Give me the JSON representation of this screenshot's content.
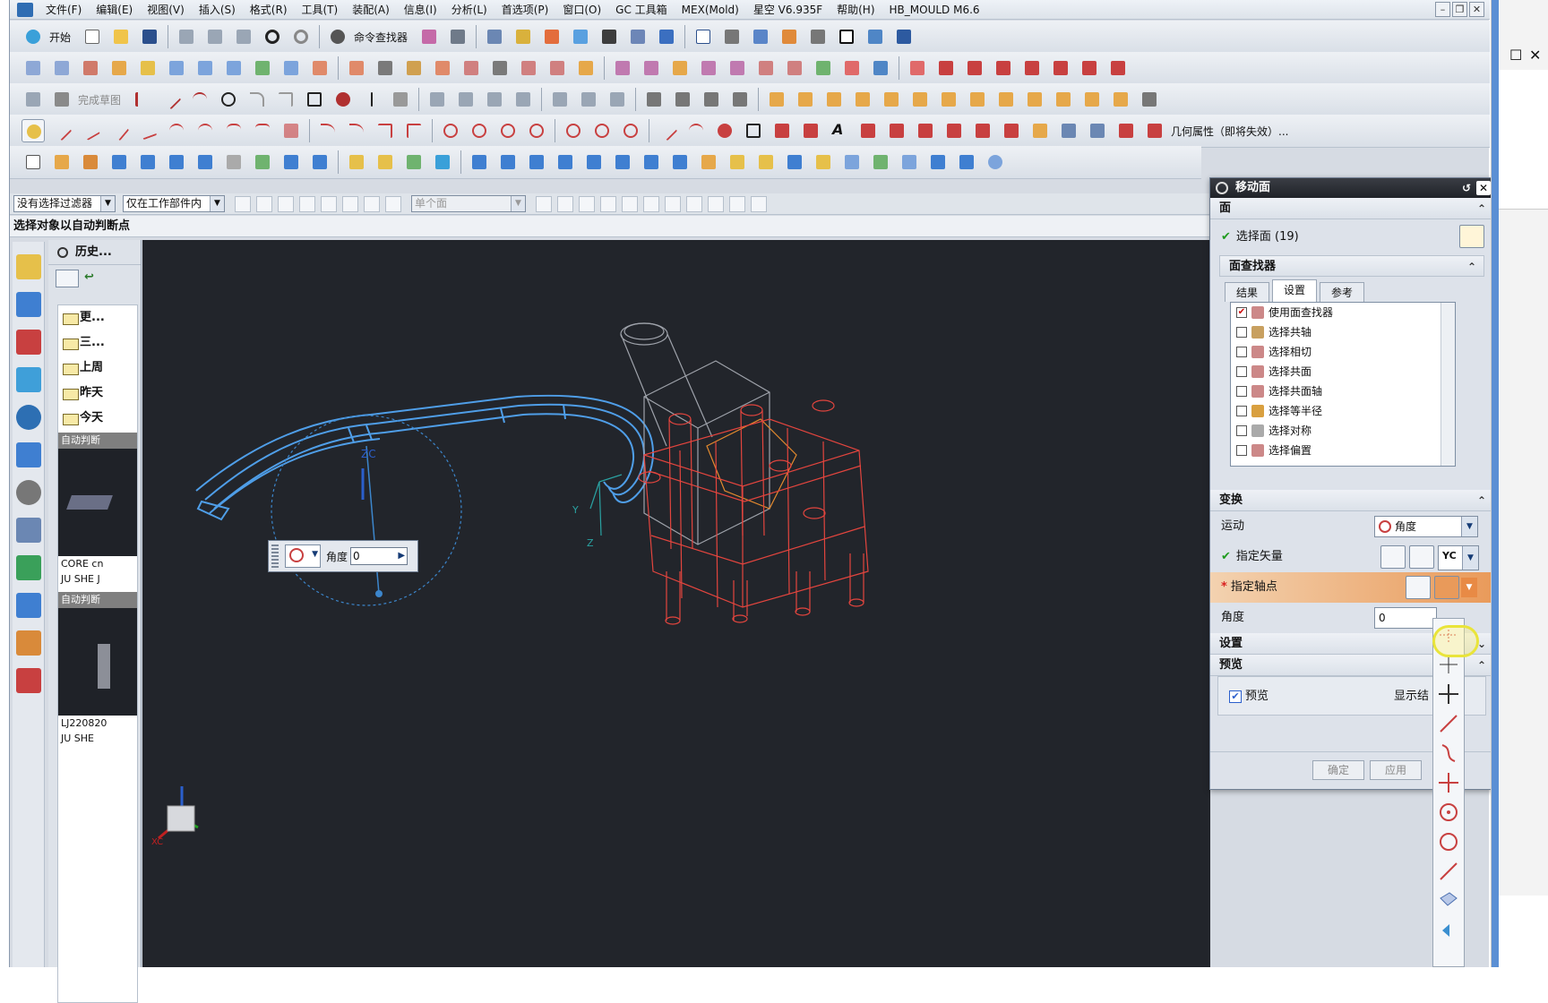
{
  "menubar": {
    "items": [
      "文件(F)",
      "编辑(E)",
      "视图(V)",
      "插入(S)",
      "格式(R)",
      "工具(T)",
      "装配(A)",
      "信息(I)",
      "分析(L)",
      "首选项(P)",
      "窗口(O)",
      "GC 工具箱",
      "MEX(Mold)",
      "星空 V6.935F",
      "帮助(H)",
      "HB_MOULD M6.6"
    ]
  },
  "toolbar1": {
    "start_label": "开始",
    "command_finder_label": "命令查找器"
  },
  "toolbar3": {
    "sketch_label": "完成草图"
  },
  "toolbar4": {
    "geom_props_label": "几何属性（即将失效）..."
  },
  "filterbar": {
    "type_filter": "没有选择过滤器",
    "scope_filter": "仅在工作部件内",
    "face_rule": "单个面"
  },
  "status": {
    "prompt": "选择对象以自动判断点"
  },
  "nav": {
    "title": "历史...",
    "groups": [
      "更...",
      "三...",
      "上周",
      "昨天",
      "今天"
    ],
    "thumbs": [
      {
        "header": "自动判断",
        "caption1": "CORE cn",
        "caption2": "JU SHE J"
      },
      {
        "header": "自动判断",
        "caption1": "LJ220820",
        "caption2": "JU  SHE"
      }
    ]
  },
  "viewport": {
    "popup": {
      "label": "角度",
      "value": "0"
    },
    "axis": {
      "zc": "ZC",
      "xc": "XC",
      "y": "Y",
      "z": "Z"
    }
  },
  "dialog": {
    "title": "移动面",
    "face_section": "面",
    "select_face_label": "选择面 (19)",
    "finder_section": "面查找器",
    "tabs": [
      "结果",
      "设置",
      "参考"
    ],
    "finder_options": [
      "使用面查找器",
      "选择共轴",
      "选择相切",
      "选择共面",
      "选择共面轴",
      "选择等半径",
      "选择对称",
      "选择偏置"
    ],
    "transform_section": "变换",
    "motion_label": "运动",
    "motion_value": "角度",
    "vector_label": "指定矢量",
    "vector_value": "YC",
    "pivot_label": "指定轴点",
    "angle_label": "角度",
    "angle_value": "0",
    "settings_section": "设置",
    "preview_section": "预览",
    "preview_label": "预览",
    "show_result_label": "显示结",
    "ok_label": "确定",
    "apply_label": "应用"
  },
  "colors": {
    "viewport_bg": "#22252b",
    "blue_part": "#4f9ee8",
    "red_part": "#e3453e",
    "accent_orange": "#e99a5a"
  }
}
